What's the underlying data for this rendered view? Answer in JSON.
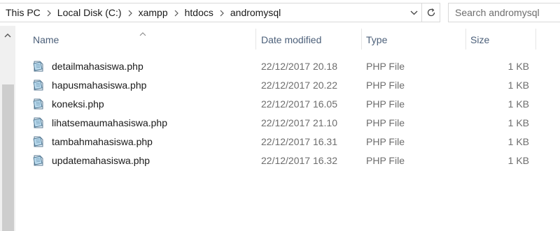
{
  "address": {
    "breadcrumbs": [
      "This PC",
      "Local Disk (C:)",
      "xampp",
      "htdocs",
      "andromysql"
    ],
    "dropdown_icon": "chevron-down-icon",
    "refresh_icon": "refresh-icon"
  },
  "search": {
    "placeholder": "Search andromysql"
  },
  "columns": {
    "name": "Name",
    "date": "Date modified",
    "type": "Type",
    "size": "Size"
  },
  "files": [
    {
      "name": "detailmahasiswa.php",
      "date": "22/12/2017 20.18",
      "type": "PHP File",
      "size": "1 KB"
    },
    {
      "name": "hapusmahasiswa.php",
      "date": "22/12/2017 20.22",
      "type": "PHP File",
      "size": "1 KB"
    },
    {
      "name": "koneksi.php",
      "date": "22/12/2017 16.05",
      "type": "PHP File",
      "size": "1 KB"
    },
    {
      "name": "lihatsemaumahasiswa.php",
      "date": "22/12/2017 21.10",
      "type": "PHP File",
      "size": "1 KB"
    },
    {
      "name": "tambahmahasiswa.php",
      "date": "22/12/2017 16.31",
      "type": "PHP File",
      "size": "1 KB"
    },
    {
      "name": "updatemahasiswa.php",
      "date": "22/12/2017 16.32",
      "type": "PHP File",
      "size": "1 KB"
    }
  ],
  "colors": {
    "header_text": "#4c607a",
    "secondary_text": "#6d6d6d",
    "scroll_track": "#f0f0f0",
    "scroll_thumb": "#cdcdcd"
  }
}
